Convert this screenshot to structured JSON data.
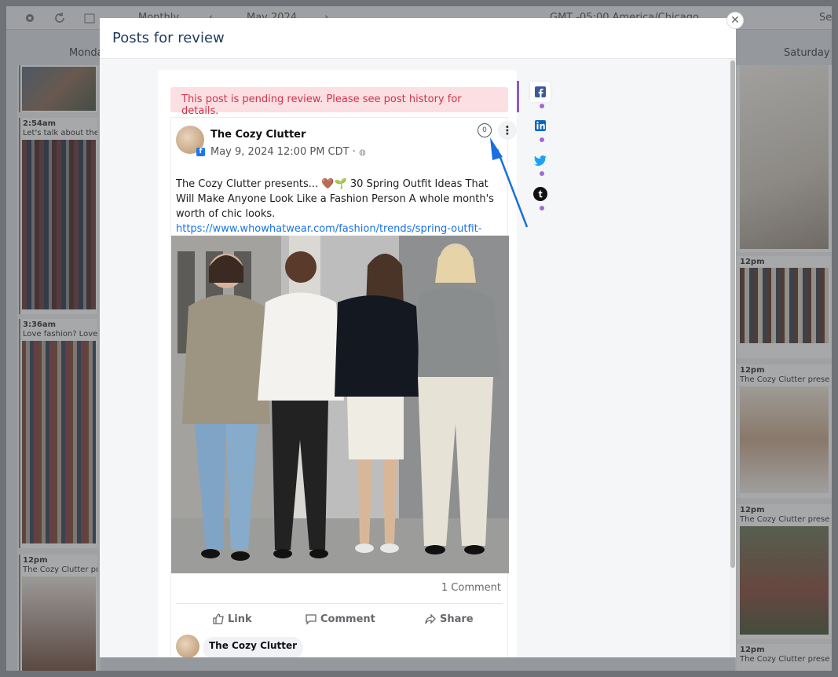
{
  "background": {
    "toolbar": {
      "view_select": "Monthly",
      "month_label": "May 2024",
      "timezone": "GMT -05:00 America/Chicago",
      "search_stub": "Se"
    },
    "days": {
      "left": "Monda",
      "right": "Saturday"
    },
    "left_cards": [
      {
        "time": "2:54am",
        "caption": "Let's talk about the"
      },
      {
        "time": "3:36am",
        "caption": "Love fashion? Love"
      },
      {
        "time": "12pm",
        "caption": "The Cozy Clutter pr"
      }
    ],
    "right_cards": [
      {
        "time": "12pm",
        "caption": ""
      },
      {
        "time": "12pm",
        "caption": "The Cozy Clutter prese"
      },
      {
        "time": "12pm",
        "caption": "The Cozy Clutter prese"
      },
      {
        "time": "12pm",
        "caption": "The Cozy Clutter prese"
      }
    ]
  },
  "modal": {
    "title": "Posts for review",
    "close_icon": "close-icon",
    "pending_notice": "This post is pending review. Please see post history for details.",
    "post": {
      "page_name": "The Cozy Clutter",
      "date": "May 9, 2024 12:00 PM CDT · ",
      "comment_count": "0",
      "more_icon": "⋮",
      "text": "The Cozy Clutter presents... 🤎🌱 30 Spring Outfit Ideas That Will Make Anyone Look Like a Fashion Person A whole month's worth of chic looks. ",
      "link": "https://www.whowhatwear.com/fashion/trends/spring-outfit-ideas",
      "comments_label": "1 Comment",
      "actions": {
        "like": "Link",
        "comment": "Comment",
        "share": "Share"
      },
      "commenter_name": "The Cozy Clutter"
    },
    "networks": [
      {
        "name": "facebook",
        "icon": "facebook-icon",
        "color": "#3b5998"
      },
      {
        "name": "linkedin",
        "icon": "linkedin-icon",
        "color": "#0a66c2"
      },
      {
        "name": "twitter",
        "icon": "twitter-icon",
        "color": "#1da1f2"
      },
      {
        "name": "tumblr",
        "icon": "tumblr-icon",
        "color": "#111111"
      }
    ],
    "accent_color": "#8a5cc9",
    "pending_color": "#d0334a"
  }
}
